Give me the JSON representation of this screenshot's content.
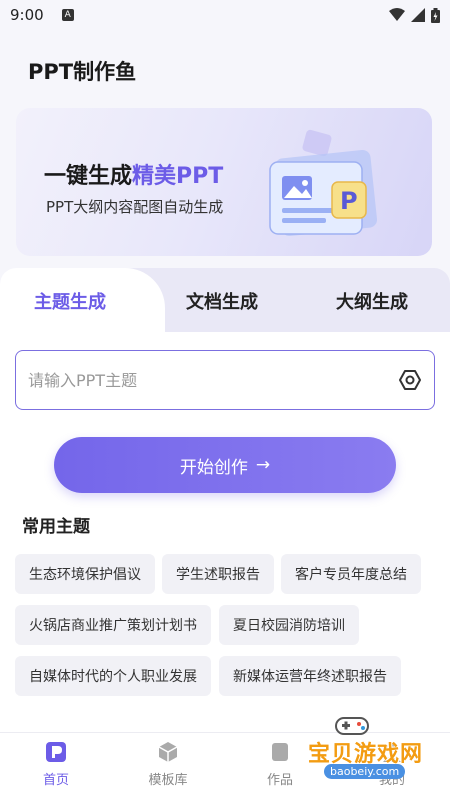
{
  "status_bar": {
    "time": "9:00",
    "notification_badge": "A"
  },
  "app_title": "PPT制作鱼",
  "banner": {
    "headline_prefix": "一键生成",
    "headline_highlight": "精美PPT",
    "subtitle": "PPT大纲内容配图自动生成",
    "illustration_letter": "P"
  },
  "tabs": [
    {
      "label": "主题生成",
      "active": true
    },
    {
      "label": "文档生成",
      "active": false
    },
    {
      "label": "大纲生成",
      "active": false
    }
  ],
  "topic_input": {
    "placeholder": "请输入PPT主题",
    "value": ""
  },
  "start_button": {
    "label": "开始创作",
    "arrow": "→"
  },
  "common_topics": {
    "title": "常用主题",
    "items": [
      "生态环境保护倡议",
      "学生述职报告",
      "客户专员年度总结",
      "火锅店商业推广策划计划书",
      "夏日校园消防培训",
      "自媒体时代的个人职业发展",
      "新媒体运营年终述职报告"
    ]
  },
  "bottom_nav": [
    {
      "label": "首页",
      "icon": "home-p-icon",
      "active": true
    },
    {
      "label": "模板库",
      "icon": "cube-icon",
      "active": false
    },
    {
      "label": "作品",
      "icon": "works-icon",
      "active": false
    },
    {
      "label": "我的",
      "icon": "profile-icon",
      "active": false
    }
  ],
  "watermark": {
    "text": "宝贝游戏网",
    "url": "baobeiy.com"
  },
  "colors": {
    "accent": "#6c5ce7",
    "background": "#f6f6fb",
    "chip_bg": "#f1f1f6"
  }
}
